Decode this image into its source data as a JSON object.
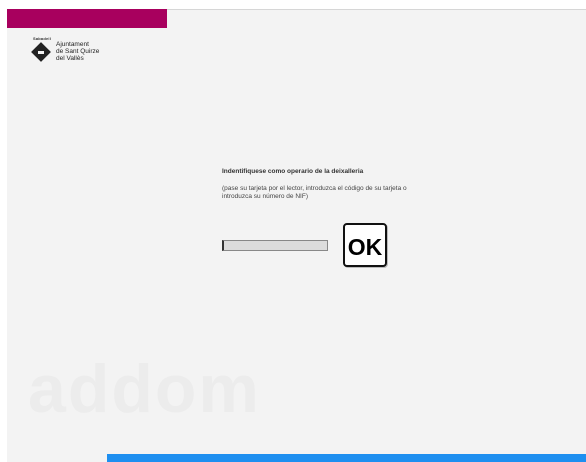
{
  "brand": {
    "bar_color": "#a8005e",
    "logo_small": "Sabadell",
    "logo_text": "Ajuntament\nde Sant Quirze\ndel Vallès"
  },
  "prompt": {
    "title": "Indentifiquese como operario de la deixalleria",
    "instructions": "(pase su tarjeta por el lector, introduzca el código de su tarjeta o introduzca su número de NIF)"
  },
  "id_input": {
    "value": "",
    "placeholder": ""
  },
  "ok_button": {
    "label": "OK"
  },
  "watermark": {
    "text": "addom"
  },
  "footer": {
    "bar_color": "#1e8ff0"
  }
}
